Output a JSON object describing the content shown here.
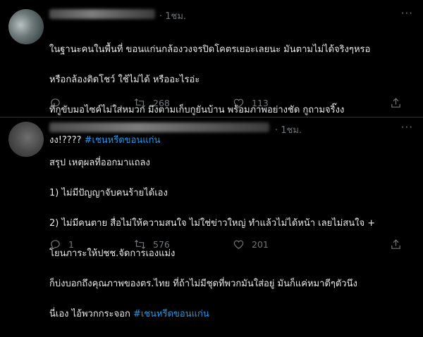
{
  "tweets": [
    {
      "time": "· 1ชม.",
      "more": "···",
      "lines": [
        "ในฐานะคนในพื้นที่ ขอนแก่นกล้องวงจรปิดโคตรเยอะเลยนะ มันตามไม่ได้จริงๆหรอ",
        "หรือกล้องติดโชว์ ใช้ไม่ได้ หรืออะไรอ่ะ",
        "ที่กูขับมอไซค์ไม่ใส่หมวก มึงตามเก็บกูยันบ้าน พร้อมภาพอย่างชัด กูถามจริ๊งง",
        "งง!???? "
      ],
      "hashtag": "#เชนหรีดขอนแก่น",
      "reply_count": "",
      "retweet_count": "268",
      "like_count": "113"
    },
    {
      "time": "· 1ชม.",
      "more": "···",
      "lines": [
        "สรุป เหตุผลที่ออกมาแถลง",
        "1) ไม่มีปัญญาจับคนร้ายได้เอง",
        "2) ไม่มีคนตาย สื่อไม่ให้ความสนใจ ไม่ใช่ข่าวใหญ่ ทำแล้วไม่ได้หน้า เลยไม่สนใจ +",
        "โยนภาระให้ปชช.จัดการเองแม่ง",
        "ก็บ่งบอกถึงคุณภาพของตร.ไทย ที่ถ้าไม่มีชุดที่พวกมันใส่อยู่ มันก็แค่หมาตีๆตัวนึง",
        "นี่เอง ไอ้พวกกระจอก "
      ],
      "hashtag": "#เชนหรีดขอนแก่น",
      "reply_count": "1",
      "retweet_count": "576",
      "like_count": "201"
    }
  ]
}
